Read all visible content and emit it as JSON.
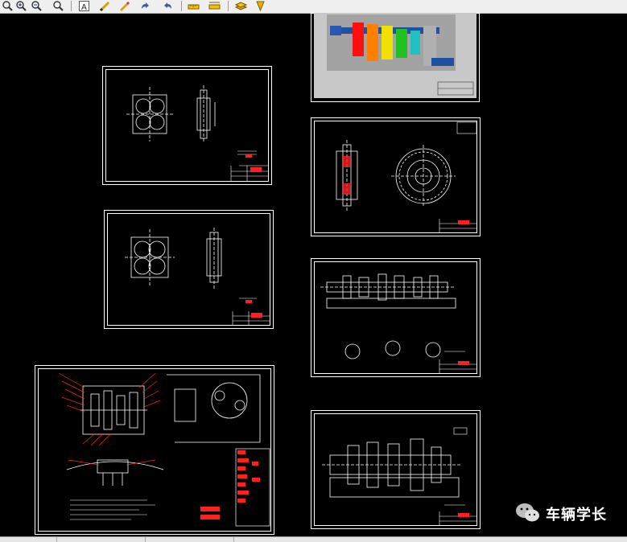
{
  "toolbar": {
    "tools": [
      {
        "name": "zoom-realtime-icon"
      },
      {
        "name": "zoom-in-icon"
      },
      {
        "name": "zoom-out-icon"
      },
      {
        "name": "zoom-window-icon"
      },
      {
        "name": "text-icon",
        "glyph": "A"
      },
      {
        "name": "pencil-icon"
      },
      {
        "name": "edit-icon"
      },
      {
        "name": "undo-icon"
      },
      {
        "name": "redo-icon"
      },
      {
        "name": "measure-icon"
      },
      {
        "name": "measure-area-icon"
      },
      {
        "name": "layers-icon"
      },
      {
        "name": "dropdown-arrow-icon"
      }
    ]
  },
  "sheets": [
    {
      "id": "sheet-housing-cover-a",
      "type": "part drawing"
    },
    {
      "id": "sheet-housing-cover-b",
      "type": "part drawing"
    },
    {
      "id": "sheet-assembly",
      "type": "assembly drawing"
    },
    {
      "id": "sheet-3d-render",
      "type": "3d render"
    },
    {
      "id": "sheet-gear",
      "type": "part drawing"
    },
    {
      "id": "sheet-shaft-a",
      "type": "part drawing"
    },
    {
      "id": "sheet-shaft-b",
      "type": "part drawing"
    }
  ],
  "watermark": {
    "text": "车辆学长",
    "icon": "wechat-icon"
  },
  "colors": {
    "canvas_bg": "#000000",
    "line": "#ffffff",
    "accent_red": "#ff2020",
    "toolbar_bg": "#f0f0f0"
  }
}
